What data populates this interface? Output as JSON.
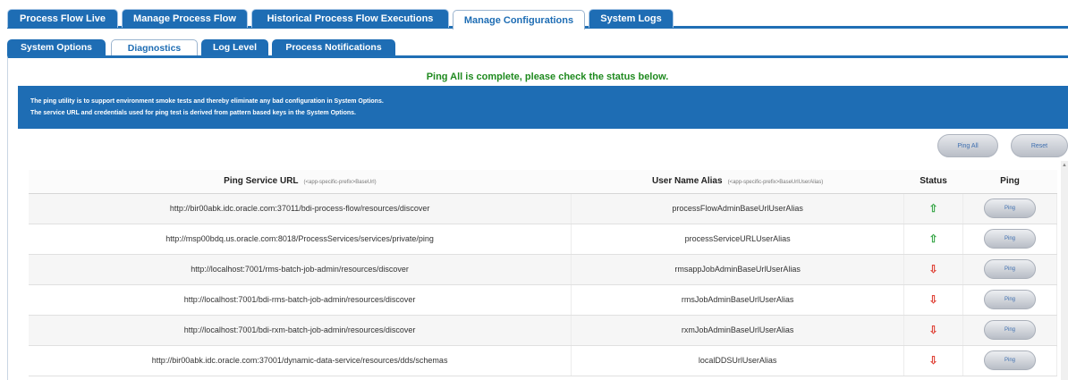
{
  "top_tabs": [
    {
      "label": "Process Flow Live"
    },
    {
      "label": "Manage Process Flow"
    },
    {
      "label": "Historical Process Flow Executions"
    },
    {
      "label": "Manage Configurations"
    },
    {
      "label": "System Logs"
    }
  ],
  "sub_tabs": [
    {
      "label": "System Options"
    },
    {
      "label": "Diagnostics"
    },
    {
      "label": "Log Level"
    },
    {
      "label": "Process Notifications"
    }
  ],
  "status_message": "Ping All is complete, please check the status below.",
  "info": {
    "line1": "The ping utility is to support environment smoke tests and thereby eliminate any bad configuration in System Options.",
    "line2": "The service URL and credentials used for ping test is derived from pattern based keys in the System Options."
  },
  "buttons": {
    "ping_all": "Ping All",
    "reset": "Reset"
  },
  "table": {
    "headers": {
      "url": "Ping Service URL",
      "url_hint": "(<app-specific-prefix>BaseUrl)",
      "alias": "User Name Alias",
      "alias_hint": "(<app-specific-prefix>BaseUrlUserAlias)",
      "status": "Status",
      "ping": "Ping"
    },
    "row_button": "Ping",
    "rows": [
      {
        "url": "http://bir00abk.idc.oracle.com:37011/bdi-process-flow/resources/discover",
        "alias": "processFlowAdminBaseUrlUserAlias",
        "status": "up"
      },
      {
        "url": "http://msp00bdq.us.oracle.com:8018/ProcessServices/services/private/ping",
        "alias": "processServiceURLUserAlias",
        "status": "up"
      },
      {
        "url": "http://localhost:7001/rms-batch-job-admin/resources/discover",
        "alias": "rmsappJobAdminBaseUrlUserAlias",
        "status": "down"
      },
      {
        "url": "http://localhost:7001/bdi-rms-batch-job-admin/resources/discover",
        "alias": "rmsJobAdminBaseUrlUserAlias",
        "status": "down"
      },
      {
        "url": "http://localhost:7001/bdi-rxm-batch-job-admin/resources/discover",
        "alias": "rxmJobAdminBaseUrlUserAlias",
        "status": "down"
      },
      {
        "url": "http://bir00abk.idc.oracle.com:37001/dynamic-data-service/resources/dds/schemas",
        "alias": "localDDSUrlUserAlias",
        "status": "down"
      }
    ]
  },
  "colors": {
    "tab_blue": "#1e6db4",
    "status_green": "#1f8a1f",
    "up_arrow": "#3aa84a",
    "down_arrow": "#e0453a"
  }
}
